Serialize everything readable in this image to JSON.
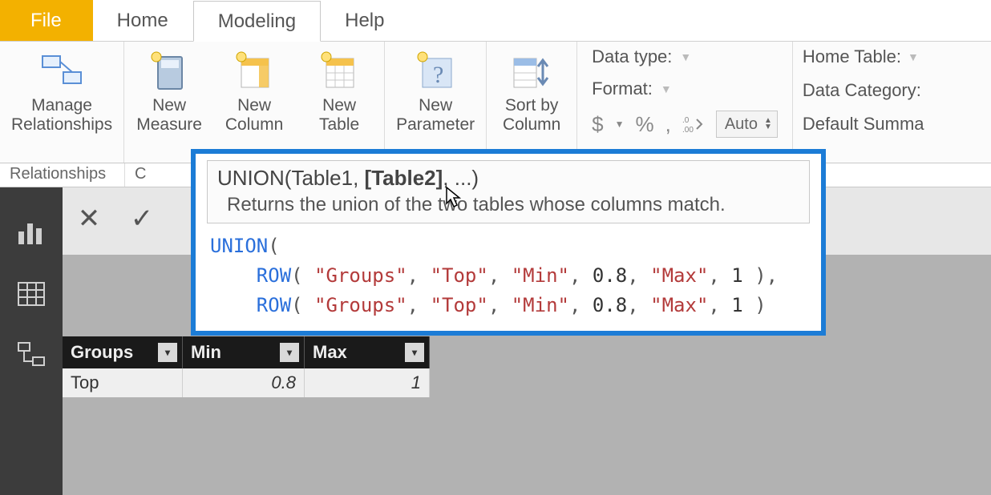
{
  "tabs": {
    "file": "File",
    "home": "Home",
    "modeling": "Modeling",
    "help": "Help"
  },
  "ribbon": {
    "manage_relationships": "Manage\nRelationships",
    "new_measure": "New\nMeasure",
    "new_column": "New\nColumn",
    "new_table": "New\nTable",
    "new_parameter": "New\nParameter",
    "sort_by_column": "Sort by\nColumn",
    "data_type": "Data type:",
    "format": "Format:",
    "currency": "$",
    "percent": "%",
    "comma": ",",
    "decimal_icon": ".00",
    "auto": "Auto",
    "home_table": "Home Table:",
    "data_category": "Data Category:",
    "default_summa": "Default Summa"
  },
  "group_labels": {
    "relationships": "Relationships",
    "calculations_initial": "C"
  },
  "tooltip": {
    "sig_fn": "UNION",
    "sig_arg1": "Table1",
    "sig_arg2": "[Table2]",
    "sig_rest": ", ...)",
    "desc": "Returns the union of the two tables whose columns match."
  },
  "code": {
    "fn_union": "UNION",
    "fn_row": "ROW",
    "s_groups": "\"Groups\"",
    "s_top": "\"Top\"",
    "s_min": "\"Min\"",
    "s_max": "\"Max\"",
    "n1": "0.8",
    "n2": "1"
  },
  "table": {
    "cols": [
      "Groups",
      "Min",
      "Max"
    ],
    "row0": {
      "c0": "Top",
      "c1": "0.8",
      "c2": "1"
    }
  }
}
